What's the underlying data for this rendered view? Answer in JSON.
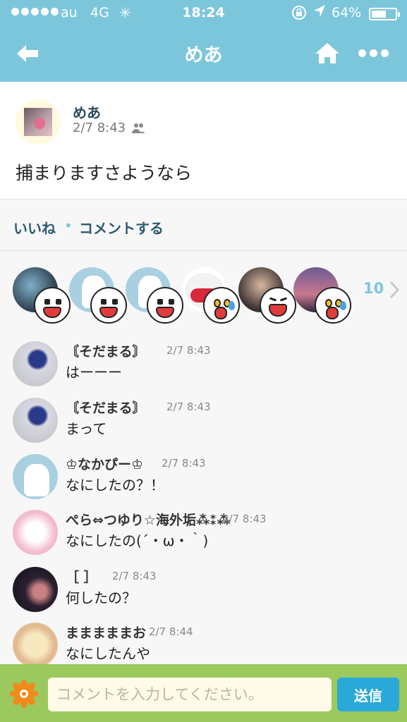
{
  "status_bar": {
    "carrier": "au",
    "network": "4G",
    "time": "18:24",
    "battery_percent": "64%",
    "battery_level": 0.64
  },
  "nav": {
    "title": "めあ"
  },
  "post": {
    "author": "めあ",
    "timestamp": "2/7 8:43",
    "body": "捕まりますさようなら"
  },
  "actions": {
    "like_label": "いいね",
    "separator": "•",
    "comment_label": "コメントする"
  },
  "likers": {
    "count": "10",
    "items": [
      {
        "emoji": "crying"
      },
      {
        "emoji": "crying"
      },
      {
        "emoji": "crying"
      },
      {
        "emoji": "shocked"
      },
      {
        "emoji": "laughing"
      },
      {
        "emoji": "shocked"
      }
    ]
  },
  "comments": [
    {
      "name": "〘そだまる〙",
      "time": "2/7 8:43",
      "text": "はーーー"
    },
    {
      "name": "〘そだまる〙",
      "time": "2/7 8:43",
      "text": "まって"
    },
    {
      "name": "♔なかぴー♔",
      "time": "2/7 8:43",
      "text": "なにしたの？！"
    },
    {
      "name": "ぺら⇔つゆり☆海外垢⁂⁑⁂",
      "time": "2/7 8:43",
      "text": "なにしたの(´・ω・｀)"
    },
    {
      "name": "［ ］",
      "time": "2/7 8:43",
      "text": "何したの？"
    },
    {
      "name": "まままままお",
      "time": "2/7 8:44",
      "text": "なにしたんや"
    }
  ],
  "input": {
    "placeholder": "コメントを入力してください。",
    "send_label": "送信"
  },
  "colors": {
    "nav_bg": "#7cc6dc",
    "input_bar_bg": "#9bc95e",
    "send_button": "#2aa8d8",
    "action_text": "#2e5a70"
  }
}
